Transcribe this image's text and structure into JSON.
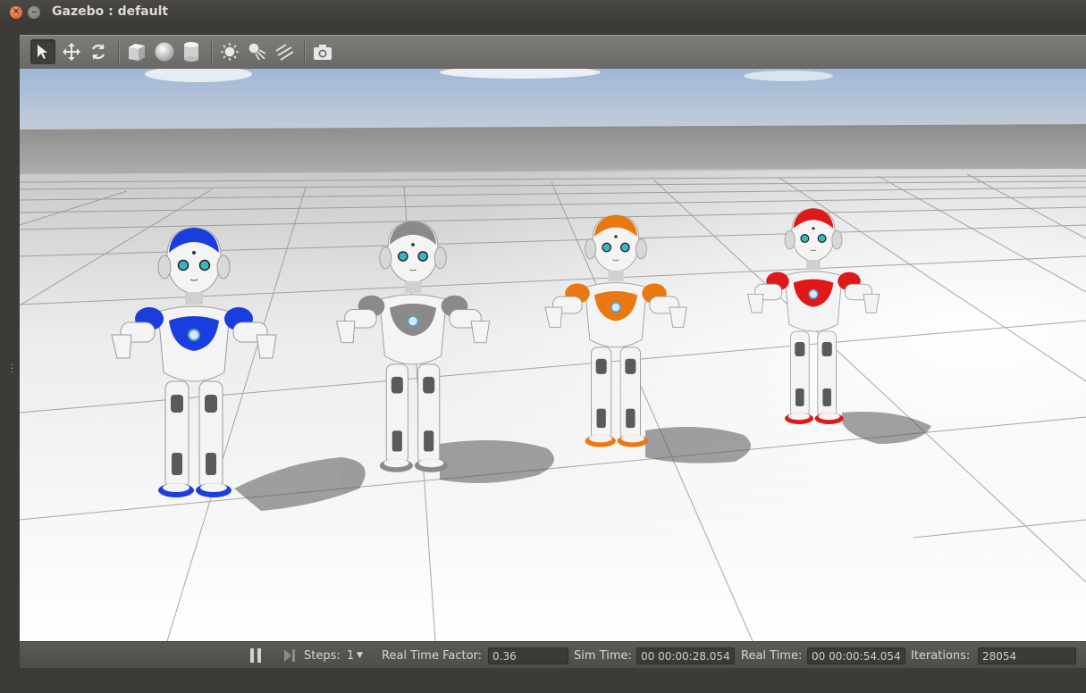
{
  "window": {
    "title": "Gazebo : default",
    "close_icon": "close-icon",
    "minimize_icon": "minimize-icon"
  },
  "toolbar": {
    "tools": [
      {
        "name": "select-arrow-icon",
        "active": true
      },
      {
        "name": "translate-icon"
      },
      {
        "name": "rotate-icon"
      },
      {
        "name": "box-shape-icon"
      },
      {
        "name": "sphere-shape-icon"
      },
      {
        "name": "cylinder-shape-icon"
      },
      {
        "name": "point-light-icon"
      },
      {
        "name": "spot-light-icon"
      },
      {
        "name": "directional-light-icon"
      },
      {
        "name": "screenshot-camera-icon"
      }
    ]
  },
  "scene": {
    "robots": [
      {
        "name": "nao-robot-blue",
        "accent": "#1a3de0"
      },
      {
        "name": "nao-robot-grey",
        "accent": "#8a8a8a"
      },
      {
        "name": "nao-robot-orange",
        "accent": "#e8780f"
      },
      {
        "name": "nao-robot-red",
        "accent": "#e01818"
      }
    ]
  },
  "statusbar": {
    "steps_label": "Steps:",
    "steps_value": "1",
    "rtf_label": "Real Time Factor:",
    "rtf_value": "0.36",
    "sim_time_label": "Sim Time:",
    "sim_time_value": "00 00:00:28.054",
    "real_time_label": "Real Time:",
    "real_time_value": "00 00:00:54.054",
    "iterations_label": "Iterations:",
    "iterations_value": "28054"
  }
}
